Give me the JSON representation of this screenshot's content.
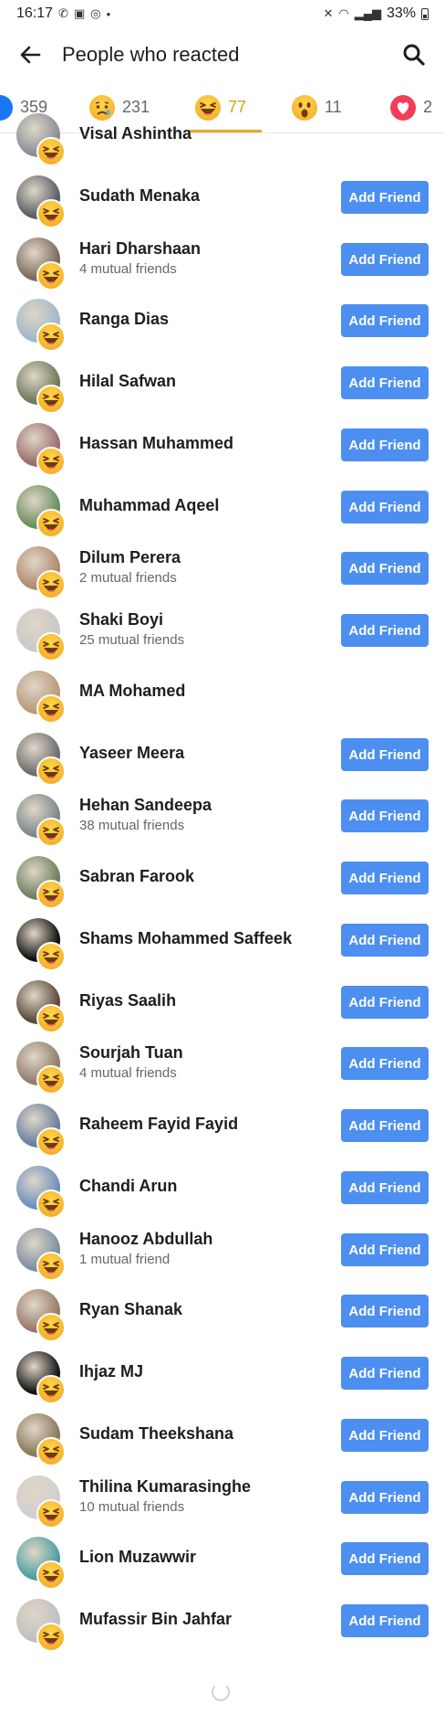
{
  "status_bar": {
    "time": "16:17",
    "battery": "33%"
  },
  "header": {
    "title": "People who reacted"
  },
  "tabs": [
    {
      "label": "359",
      "reaction": "like-icon"
    },
    {
      "label": "231",
      "reaction": "sad-icon"
    },
    {
      "label": "77",
      "reaction": "laugh-icon",
      "active": true
    },
    {
      "label": "11",
      "reaction": "wow-icon"
    },
    {
      "label": "2",
      "reaction": "love-icon"
    }
  ],
  "add_friend_label": "Add Friend",
  "people": [
    {
      "name": "Visal Ashintha",
      "mutual": "",
      "button": false
    },
    {
      "name": "Sudath Menaka",
      "mutual": "",
      "button": true
    },
    {
      "name": "Hari Dharshaan",
      "mutual": "4 mutual friends",
      "button": true
    },
    {
      "name": "Ranga Dias",
      "mutual": "",
      "button": true
    },
    {
      "name": "Hilal Safwan",
      "mutual": "",
      "button": true
    },
    {
      "name": "Hassan Muhammed",
      "mutual": "",
      "button": true
    },
    {
      "name": "Muhammad Aqeel",
      "mutual": "",
      "button": true
    },
    {
      "name": "Dilum Perera",
      "mutual": "2 mutual friends",
      "button": true
    },
    {
      "name": "Shaki Boyi",
      "mutual": "25 mutual friends",
      "button": true
    },
    {
      "name": "MA Mohamed",
      "mutual": "",
      "button": false
    },
    {
      "name": "Yaseer Meera",
      "mutual": "",
      "button": true
    },
    {
      "name": "Hehan Sandeepa",
      "mutual": "38 mutual friends",
      "button": true
    },
    {
      "name": "Sabran Farook",
      "mutual": "",
      "button": true
    },
    {
      "name": "Shams Mohammed Saffeek",
      "mutual": "",
      "button": true
    },
    {
      "name": "Riyas Saalih",
      "mutual": "",
      "button": true
    },
    {
      "name": "Sourjah Tuan",
      "mutual": "4 mutual friends",
      "button": true
    },
    {
      "name": "Raheem Fayid Fayid",
      "mutual": "",
      "button": true
    },
    {
      "name": "Chandi Arun",
      "mutual": "",
      "button": true
    },
    {
      "name": "Hanooz Abdullah",
      "mutual": "1 mutual friend",
      "button": true
    },
    {
      "name": "Ryan Shanak",
      "mutual": "",
      "button": true
    },
    {
      "name": "Ihjaz MJ",
      "mutual": "",
      "button": true
    },
    {
      "name": "Sudam Theekshana",
      "mutual": "",
      "button": true
    },
    {
      "name": "Thilina Kumarasinghe",
      "mutual": "10 mutual friends",
      "button": true
    },
    {
      "name": "Lion Muzawwir",
      "mutual": "",
      "button": true
    },
    {
      "name": "Mufassir Bin Jahfar",
      "mutual": "",
      "button": true
    }
  ],
  "colors": {
    "accent": "#4c8ff0",
    "active_tab": "#e8a823"
  }
}
